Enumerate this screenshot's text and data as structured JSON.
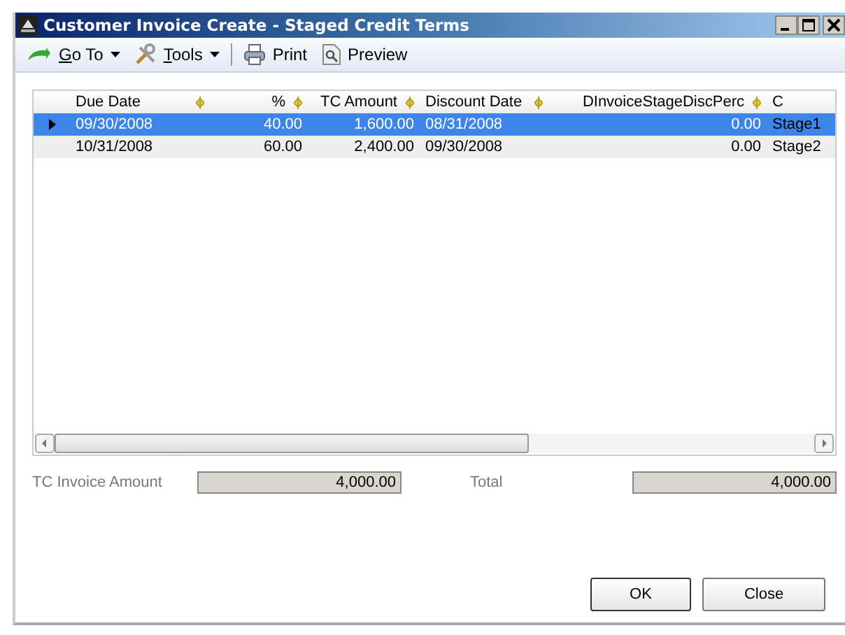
{
  "window": {
    "title": "Customer Invoice Create - Staged Credit Terms"
  },
  "toolbar": [
    {
      "kind": "goto",
      "label": "Go To",
      "dropdown": true
    },
    {
      "kind": "tools",
      "label": "Tools",
      "dropdown": true
    },
    {
      "kind": "print",
      "label": "Print",
      "dropdown": false
    },
    {
      "kind": "preview",
      "label": "Preview",
      "dropdown": false
    }
  ],
  "table": {
    "columns": [
      {
        "label": "Due Date"
      },
      {
        "label": "%"
      },
      {
        "label": "TC Amount"
      },
      {
        "label": "Discount Date"
      },
      {
        "label": "DInvoiceStageDiscPerc"
      },
      {
        "label": "C"
      }
    ],
    "rows": [
      {
        "selected": true,
        "cells": [
          "09/30/2008",
          "40.00",
          "1,600.00",
          "08/31/2008",
          "0.00",
          "Stage1"
        ]
      },
      {
        "selected": false,
        "cells": [
          "10/31/2008",
          "60.00",
          "2,400.00",
          "09/30/2008",
          "0.00",
          "Stage2"
        ]
      }
    ]
  },
  "summary": [
    {
      "label": "TC Invoice Amount",
      "value": "4,000.00"
    },
    {
      "label": "Total",
      "value": "4,000.00"
    }
  ],
  "buttons": [
    "OK",
    "Close"
  ]
}
